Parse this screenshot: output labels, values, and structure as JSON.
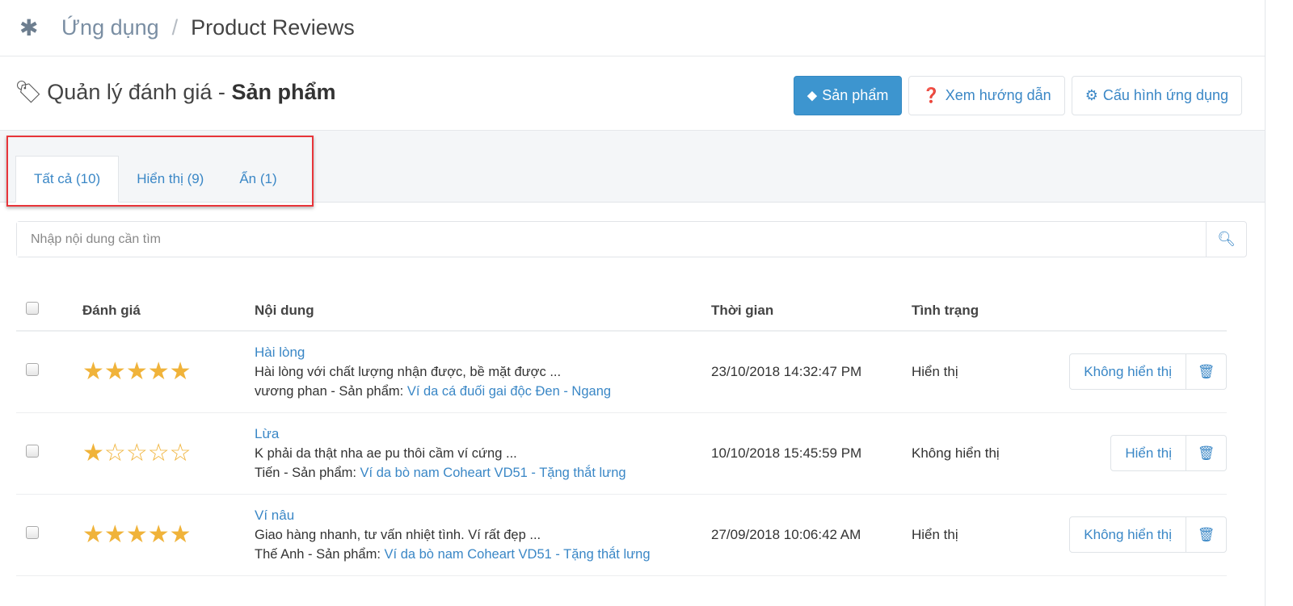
{
  "breadcrumb": {
    "icon": "puzzle-icon",
    "app": "Ứng dụng",
    "separator": "/",
    "current": "Product Reviews"
  },
  "header": {
    "title_prefix": "Quản lý đánh giá - ",
    "title_bold": "Sản phẩm",
    "buttons": [
      {
        "label": "Sản phẩm",
        "icon": "tag-icon"
      },
      {
        "label": "Xem hướng dẫn",
        "icon": "question-circle-icon"
      },
      {
        "label": "Cấu hình ứng dụng",
        "icon": "gears-icon"
      }
    ]
  },
  "tabs": [
    {
      "label": "Tất cả (10)",
      "active": true
    },
    {
      "label": "Hiển thị (9)"
    },
    {
      "label": "Ẩn (1)"
    }
  ],
  "search": {
    "placeholder": "Nhập nội dung cần tìm",
    "value": ""
  },
  "table": {
    "headers": [
      "Đánh giá",
      "Nội dung",
      "Thời gian",
      "Tình trạng"
    ],
    "rows": [
      {
        "rating": 5,
        "title": "Hài lòng",
        "content": "Hài lòng với chất lượng nhận được, bề mặt được ...",
        "author": "vương phan - Sản phẩm: ",
        "product": "Ví da cá đuối gai độc Đen - Ngang",
        "time": "23/10/2018 14:32:47 PM",
        "status": "Hiển thị",
        "action": "Không hiển thị"
      },
      {
        "rating": 1,
        "title": "Lừa",
        "content": "K phải da thật nha ae pu thôi cầm ví cứng ...",
        "author": "Tiến - Sản phẩm: ",
        "product": "Ví da bò nam Coheart VD51 - Tặng thắt lưng",
        "time": "10/10/2018 15:45:59 PM",
        "status": "Không hiển thị",
        "action": "Hiển thị"
      },
      {
        "rating": 5,
        "title": "Ví nâu",
        "content": "Giao hàng nhanh, tư vấn nhiệt tình. Ví rất đẹp ...",
        "author": "Thế Anh - Sản phẩm: ",
        "product": "Ví da bò nam Coheart VD51 - Tặng thắt lưng",
        "time": "27/09/2018 10:06:42 AM",
        "status": "Hiển thị",
        "action": "Không hiển thị"
      }
    ]
  },
  "colors": {
    "accent": "#3d95cf",
    "star": "#f0b33a",
    "highlight": "#e8353a"
  }
}
